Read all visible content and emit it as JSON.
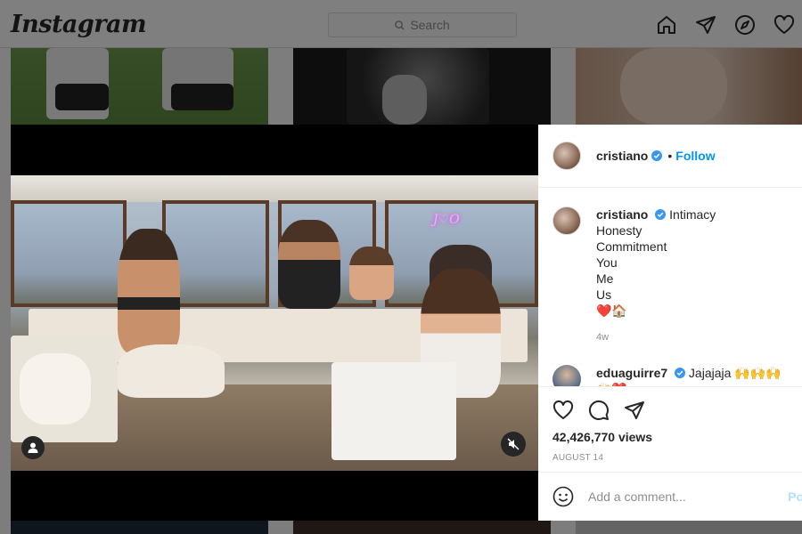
{
  "app": {
    "logo_text": "Instagram"
  },
  "search": {
    "placeholder": "Search"
  },
  "nav_icons": [
    "home-icon",
    "direct-icon",
    "explore-icon",
    "activity-heart-icon"
  ],
  "post": {
    "username": "cristiano",
    "follow_label": "Follow",
    "separator": "•",
    "caption_lines": [
      "Intimacy",
      "Honesty",
      "Commitment",
      "You",
      "Me",
      "Us",
      "❤️🏠"
    ],
    "caption_age": "4w",
    "comments": [
      {
        "username": "eduaguirre7",
        "text": "Jajajaja 🙌🙌🙌🙌❤️",
        "extra": "❤️❤️❤️❤️❤️❤️❤️❤️❤️❤️❤️"
      }
    ],
    "views": "42,426,770 views",
    "date": "AUGUST 14",
    "video_neon_text": "J♡O"
  },
  "add_comment": {
    "placeholder": "Add a comment...",
    "post_label": "Po"
  },
  "colors": {
    "accent": "#0095f6",
    "verified": "#3897f0",
    "overlay": "rgba(0,0,0,0.5)"
  }
}
